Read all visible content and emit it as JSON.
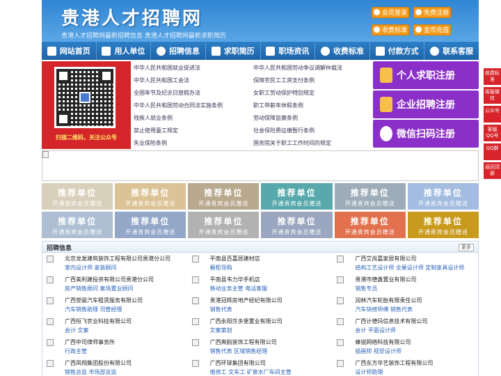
{
  "header": {
    "logo": "贵港人才招聘网",
    "slogan": "贵港人才招聘网最新招聘信息   贵港人才招聘网最新求职简历",
    "buttons": [
      "会员登录",
      "免费注册",
      "收费标准",
      "金币充值"
    ]
  },
  "nav": [
    "网站首页",
    "用人单位",
    "招聘信息",
    "求职简历",
    "职场资讯",
    "收费标准",
    "付款方式",
    "联系客服"
  ],
  "qr": {
    "caption": "扫描二维码，关注公众号"
  },
  "laws_left": [
    "中华人民共和国就业促进法",
    "中华人民共和国工会法",
    "全国年节及纪念日放假办法",
    "中华人民共和国劳动合同法实施条例",
    "残疾人就业条例",
    "禁止使用童工规定",
    "失业保险条例"
  ],
  "laws_right": [
    "中华人民共和国劳动争议调解仲裁法",
    "保障农民工工资支付条例",
    "女职工劳动保护特别规定",
    "职工带薪年休假条例",
    "劳动保障监察条例",
    "社会保险费征缴暂行条例",
    "国务院关于职工工作时间的规定"
  ],
  "register": [
    "个人求职注册",
    "企业招聘注册",
    "微信扫码注册"
  ],
  "tiles": {
    "title": "推荐单位",
    "sub": "开通贵宾会员赠送",
    "colors": [
      "#d9d0bb",
      "#dcc395",
      "#b9a98e",
      "#57a9ac",
      "#9dacb8",
      "#a3bce0",
      "#aebfd3",
      "#93a7c9",
      "#b2b2b2",
      "#9ba7c0",
      "#e2714d",
      "#c89a1e"
    ]
  },
  "jobs": {
    "title": "招聘信息",
    "more": "更多",
    "items": [
      {
        "company": "北京龙发建筑装饰工程有限公司贵港分公司",
        "positions": "室内设计师 家装顾问"
      },
      {
        "company": "平南县百嘉居建材店",
        "positions": "橱柜导购"
      },
      {
        "company": "广西艾尚嘉家居有限公司",
        "positions": "结构工艺设计师 全屋设计师 定制家具设计师"
      },
      {
        "company": "广西美利建投资有限公司贵港分公司",
        "positions": "房产销售顾问 案场置业顾问"
      },
      {
        "company": "平南县韦力华手机店",
        "positions": "移动业务主管 电话客服"
      },
      {
        "company": "贵港市德鑫置业有限公司",
        "positions": "销售专员"
      },
      {
        "company": "广西誉骏汽车租赁服务有限公司",
        "positions": "汽车销售助理 司管经理"
      },
      {
        "company": "贵港冠辉房地产经纪有限公司",
        "positions": "销售代表"
      },
      {
        "company": "润林汽车轮胎有限责任公司",
        "positions": "汽车快修师傅 销售代表"
      },
      {
        "company": "广西恒飞农业科技有限公司",
        "positions": "会计 文案"
      },
      {
        "company": "广西永阳莎多堡置业有限公司",
        "positions": "文案策划"
      },
      {
        "company": "广西计德玛信息技术有限公司",
        "positions": "会计 平面设计师"
      },
      {
        "company": "广西中司律师事务所",
        "positions": "行政主管"
      },
      {
        "company": "广西爽韵装饰工程有限公司",
        "positions": "销售代表 区域销售经理"
      },
      {
        "company": "蜂锐网络科技有限公司",
        "positions": "插画师 视觉设计师"
      },
      {
        "company": "广西凤翔集团股份有限公司",
        "positions": "销售总监 市场部总监"
      },
      {
        "company": "广西环球集团有限公司",
        "positions": "维修工 文车工 矿泉水厂车间主管"
      },
      {
        "company": "广西东方华艺装饰工程有限公司",
        "positions": "设计师助理"
      }
    ]
  },
  "side": [
    "收费标准",
    "客服微信",
    "公众号",
    "客服QQ号",
    "QQ群",
    "返回顶部"
  ]
}
